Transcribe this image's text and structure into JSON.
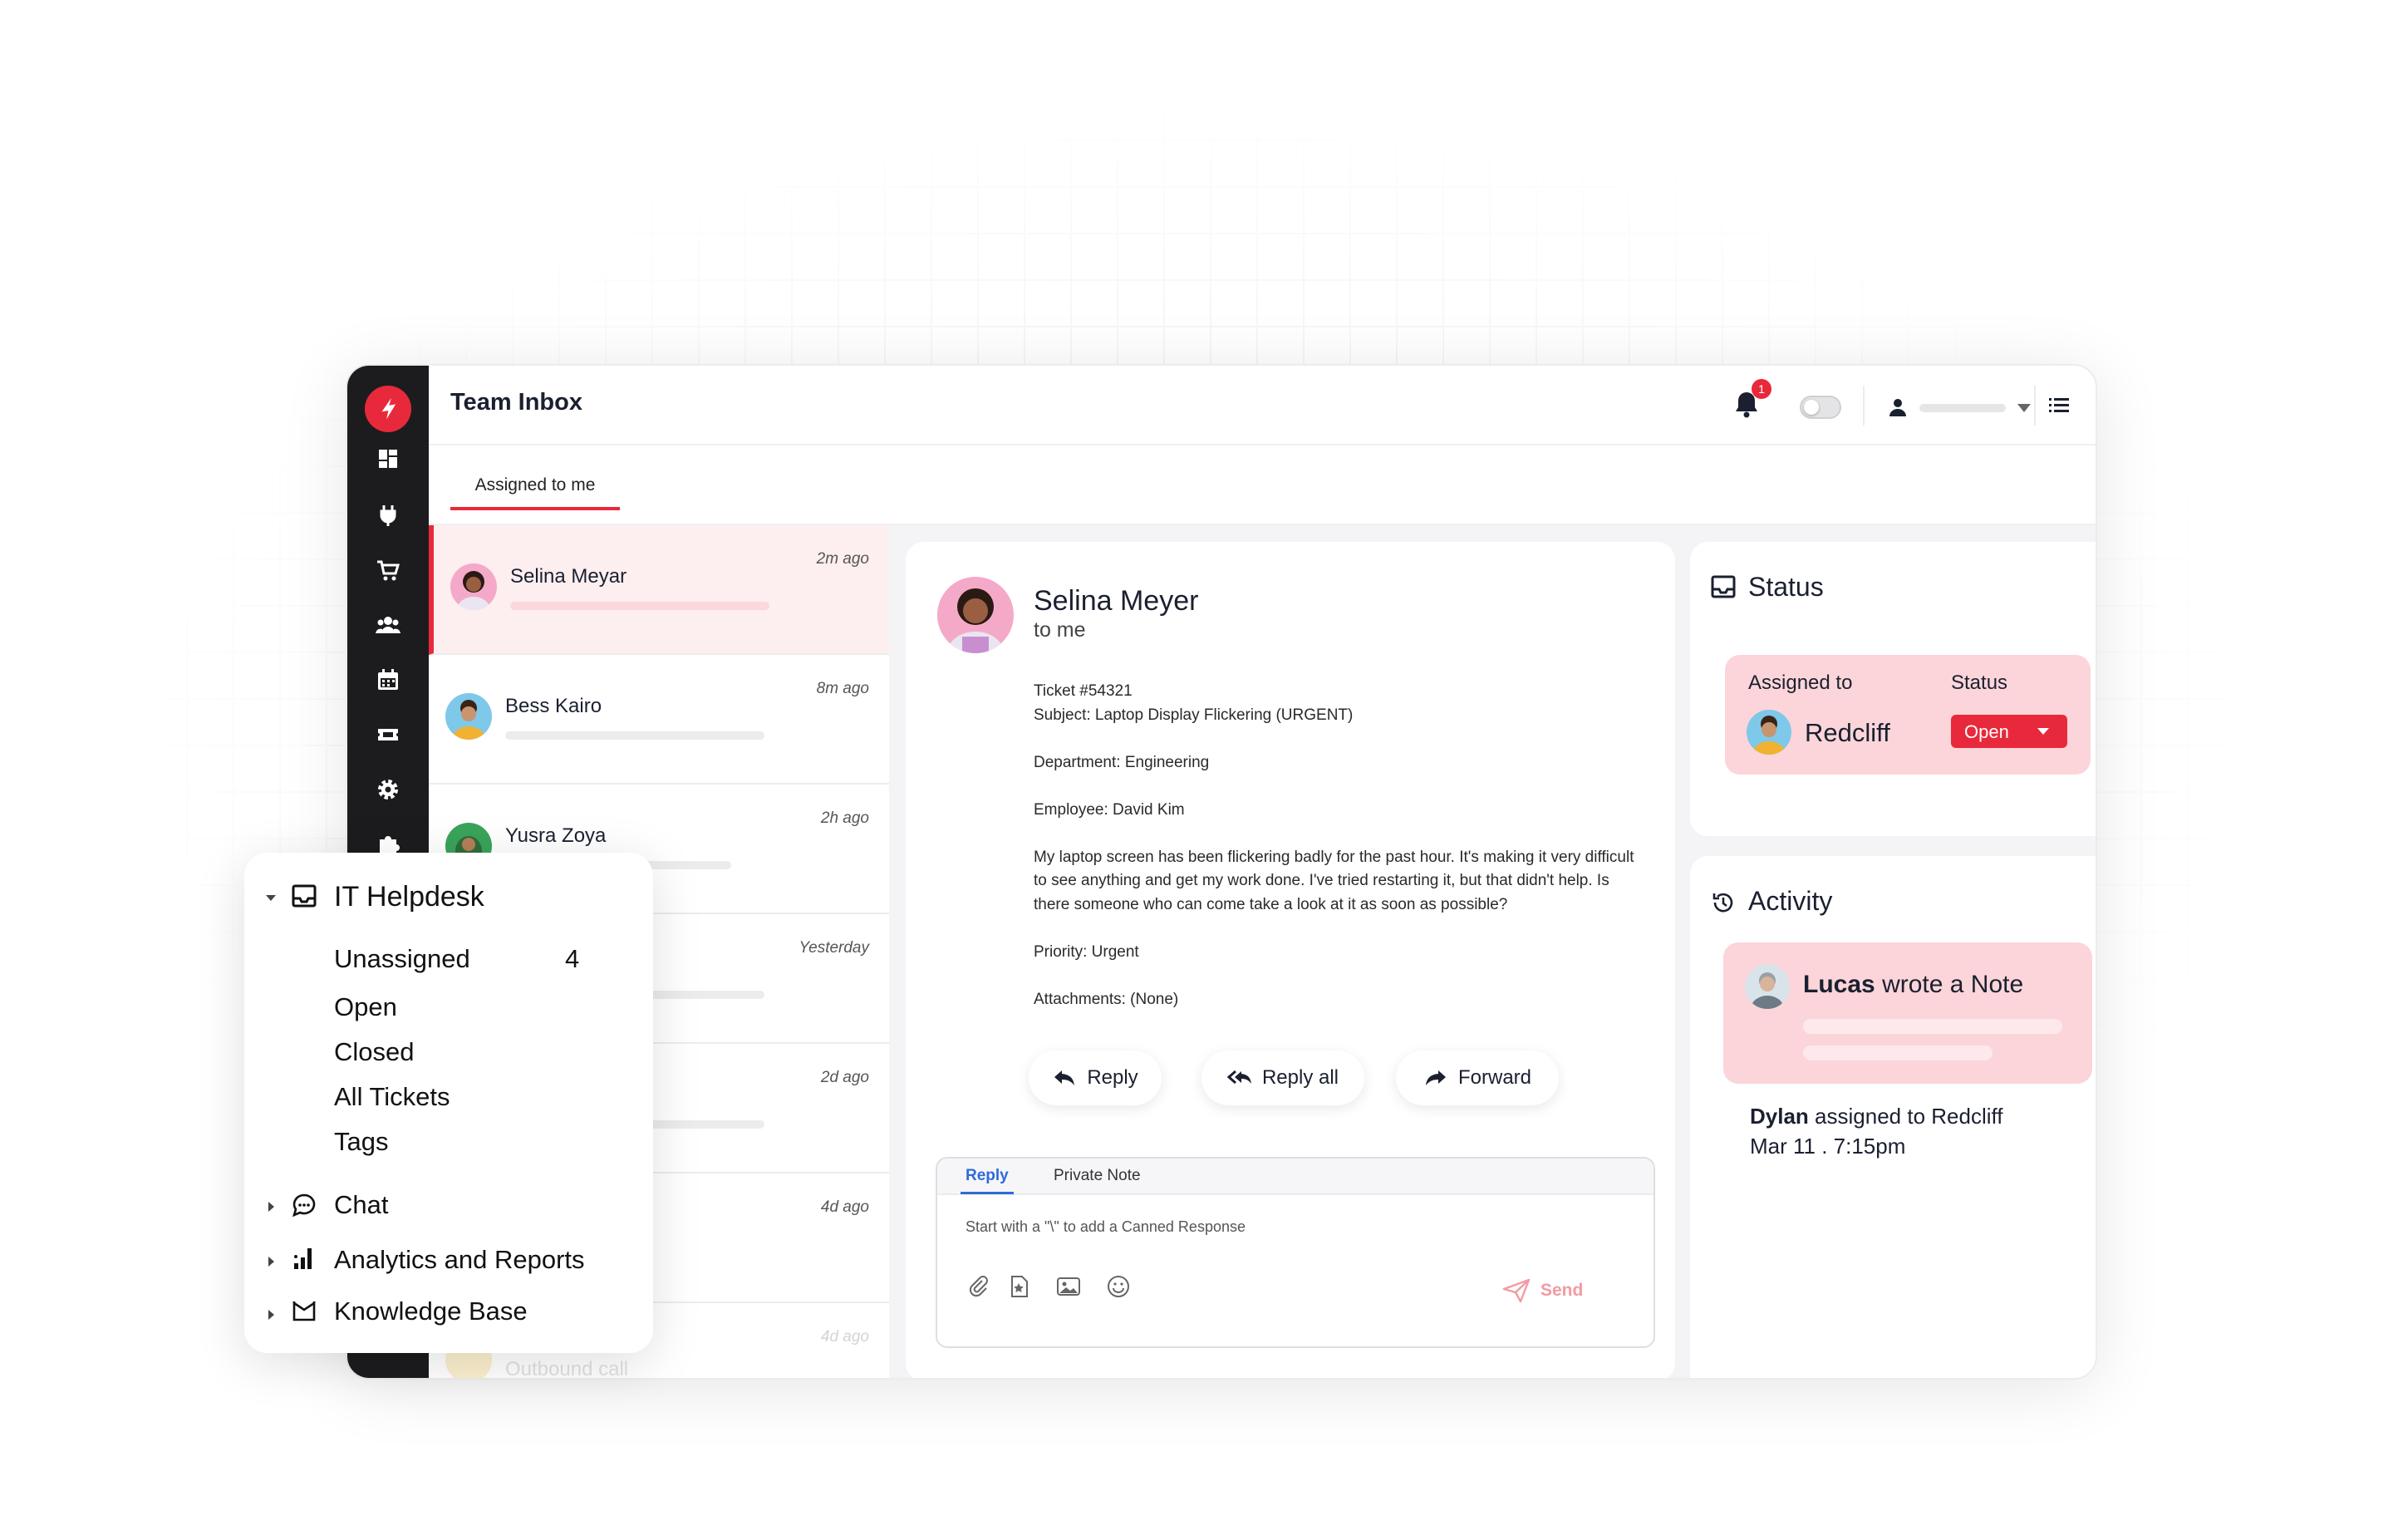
{
  "app": {
    "title": "Team Inbox",
    "notification_count": "1",
    "tab_assigned": "Assigned to me"
  },
  "conversations": [
    {
      "name": "Selina Meyar",
      "time": "2m ago"
    },
    {
      "name": "Bess Kairo",
      "time": "8m ago"
    },
    {
      "name": "Yusra Zoya",
      "time": "2h ago"
    },
    {
      "name": "",
      "time": "Yesterday"
    },
    {
      "name": "",
      "time": "2d ago"
    },
    {
      "name": "",
      "time": "4d ago"
    },
    {
      "name": "Outbound call",
      "time": "4d ago"
    }
  ],
  "message": {
    "sender": "Selina Meyer",
    "to": "to me",
    "ticket": "Ticket #54321",
    "subject": "Subject: Laptop Display Flickering (URGENT)",
    "department": "Department: Engineering",
    "employee": "Employee: David Kim",
    "body": "My laptop screen has been flickering badly for the past hour. It's making it very difficult to see anything and get my work done. I've tried restarting it, but that didn't help. Is there someone who can come take a look at it as soon as possible?",
    "priority": "Priority: Urgent",
    "attachments": "Attachments: (None)",
    "actions": {
      "reply": "Reply",
      "reply_all": "Reply all",
      "forward": "Forward"
    }
  },
  "reply_box": {
    "tab_reply": "Reply",
    "tab_note": "Private Note",
    "placeholder": "Start with a \"\\\" to add a Canned Response",
    "send": "Send"
  },
  "status_panel": {
    "title": "Status",
    "assigned_label": "Assigned to",
    "status_label": "Status",
    "assignee": "Redcliff",
    "status_value": "Open"
  },
  "activity_panel": {
    "title": "Activity",
    "note_author": "Lucas",
    "note_text": "wrote a Note",
    "assign_actor": "Dylan",
    "assign_text": "assigned to Redcliff",
    "assign_time": "Mar 11 . 7:15pm"
  },
  "helpdesk": {
    "title": "IT Helpdesk",
    "items": [
      {
        "label": "Unassigned",
        "count": "4"
      },
      {
        "label": "Open",
        "count": ""
      },
      {
        "label": "Closed",
        "count": ""
      },
      {
        "label": "All Tickets",
        "count": ""
      },
      {
        "label": "Tags",
        "count": ""
      }
    ],
    "chat": "Chat",
    "analytics": "Analytics and Reports",
    "knowledge": "Knowledge Base"
  },
  "colors": {
    "accent": "#e8293b",
    "sidebar": "#1c1c1e",
    "card_pink": "#fbd5d9",
    "link_blue": "#2f6bd8"
  },
  "icons": [
    "dashboard-icon",
    "plug-icon",
    "cart-icon",
    "team-icon",
    "calendar-icon",
    "ticket-icon",
    "gear-icon",
    "puzzle-icon",
    "bell-icon",
    "user-icon",
    "list-icon",
    "inbox-icon",
    "clock-icon",
    "chat-icon",
    "analytics-icon",
    "knowledge-icon",
    "paperclip-icon",
    "canned-icon",
    "image-icon",
    "emoji-icon",
    "send-icon"
  ]
}
